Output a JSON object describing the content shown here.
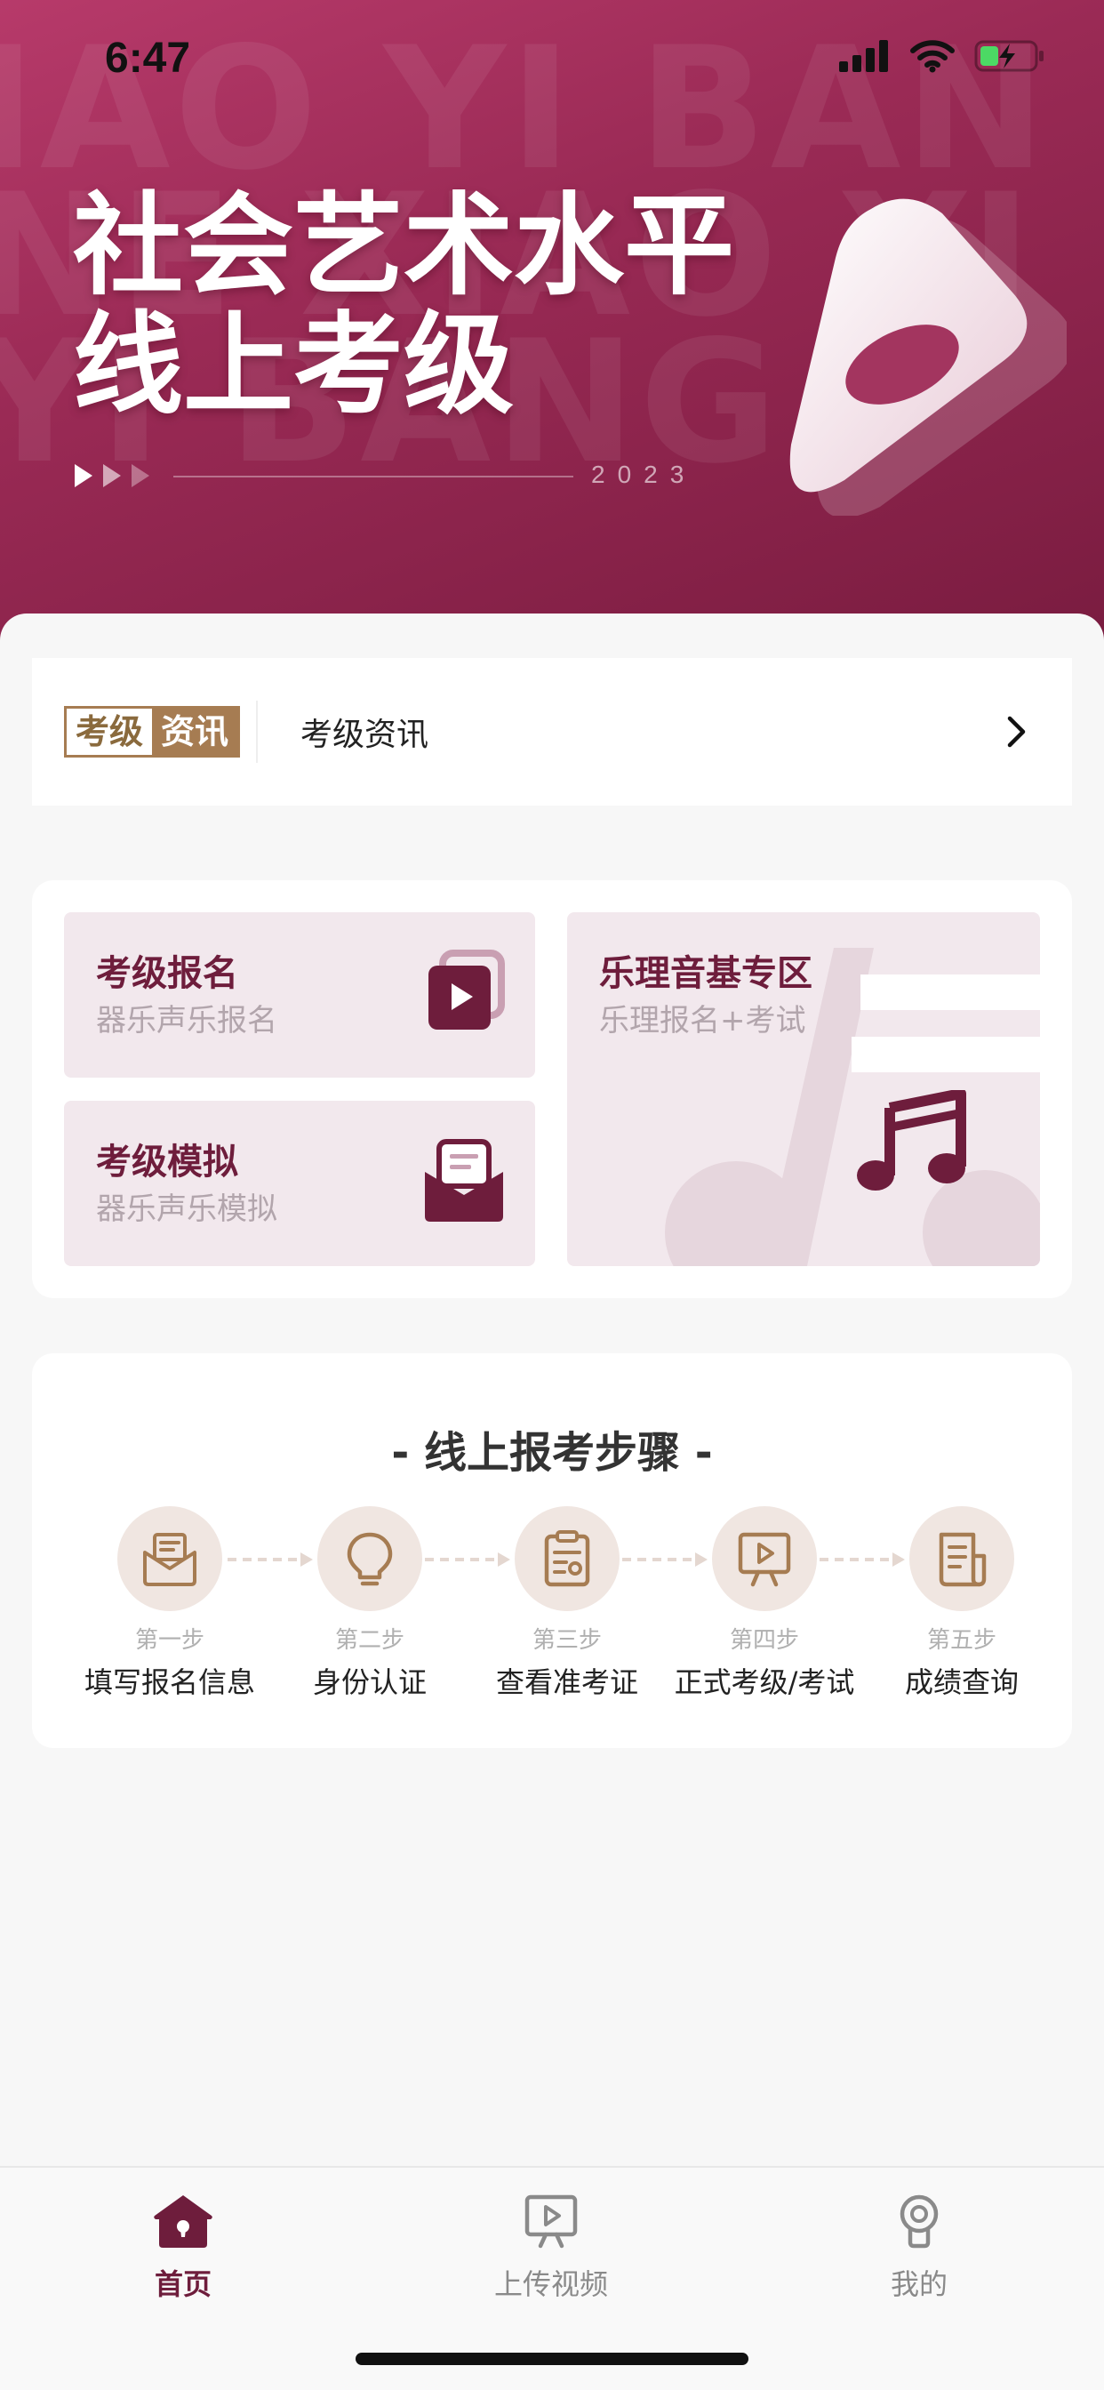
{
  "status_bar": {
    "time": "6:47"
  },
  "hero": {
    "watermark": "IAO YI BAN\nNE XIAO YI\nYI BANG",
    "title_line1": "社会艺术水平",
    "title_line2": "线上考级",
    "year": "2023",
    "colors": {
      "start": "#b73a6a",
      "end": "#7a1c40"
    }
  },
  "news": {
    "badge_left": "考级",
    "badge_right": "资讯",
    "label": "考级资讯",
    "chevron_icon": "chevron-right-icon"
  },
  "features": [
    {
      "title": "考级报名",
      "subtitle": "器乐声乐报名",
      "icon": "play-cards-icon"
    },
    {
      "title": "考级模拟",
      "subtitle": "器乐声乐模拟",
      "icon": "mail-tray-icon"
    },
    {
      "title": "乐理音基专区",
      "subtitle": "乐理报名+考试",
      "icon": "music-note-icon"
    }
  ],
  "steps": {
    "title": "- 线上报考步骤 -",
    "items": [
      {
        "num": "第一步",
        "label": "填写报名信息",
        "icon": "envelope-icon"
      },
      {
        "num": "第二步",
        "label": "身份认证",
        "icon": "lightbulb-icon"
      },
      {
        "num": "第三步",
        "label": "查看准考证",
        "icon": "clipboard-icon"
      },
      {
        "num": "第四步",
        "label": "正式考级/考试",
        "icon": "video-play-icon"
      },
      {
        "num": "第五步",
        "label": "成绩查询",
        "icon": "document-icon"
      }
    ]
  },
  "tabbar": {
    "items": [
      {
        "label": "首页",
        "icon": "home-icon",
        "active": true
      },
      {
        "label": "上传视频",
        "icon": "upload-video-icon",
        "active": false
      },
      {
        "label": "我的",
        "icon": "profile-icon",
        "active": false
      }
    ]
  },
  "colors": {
    "accent": "#6e1d3c",
    "step_icon": "#a67c52",
    "card_bg": "#f2e8ed"
  }
}
